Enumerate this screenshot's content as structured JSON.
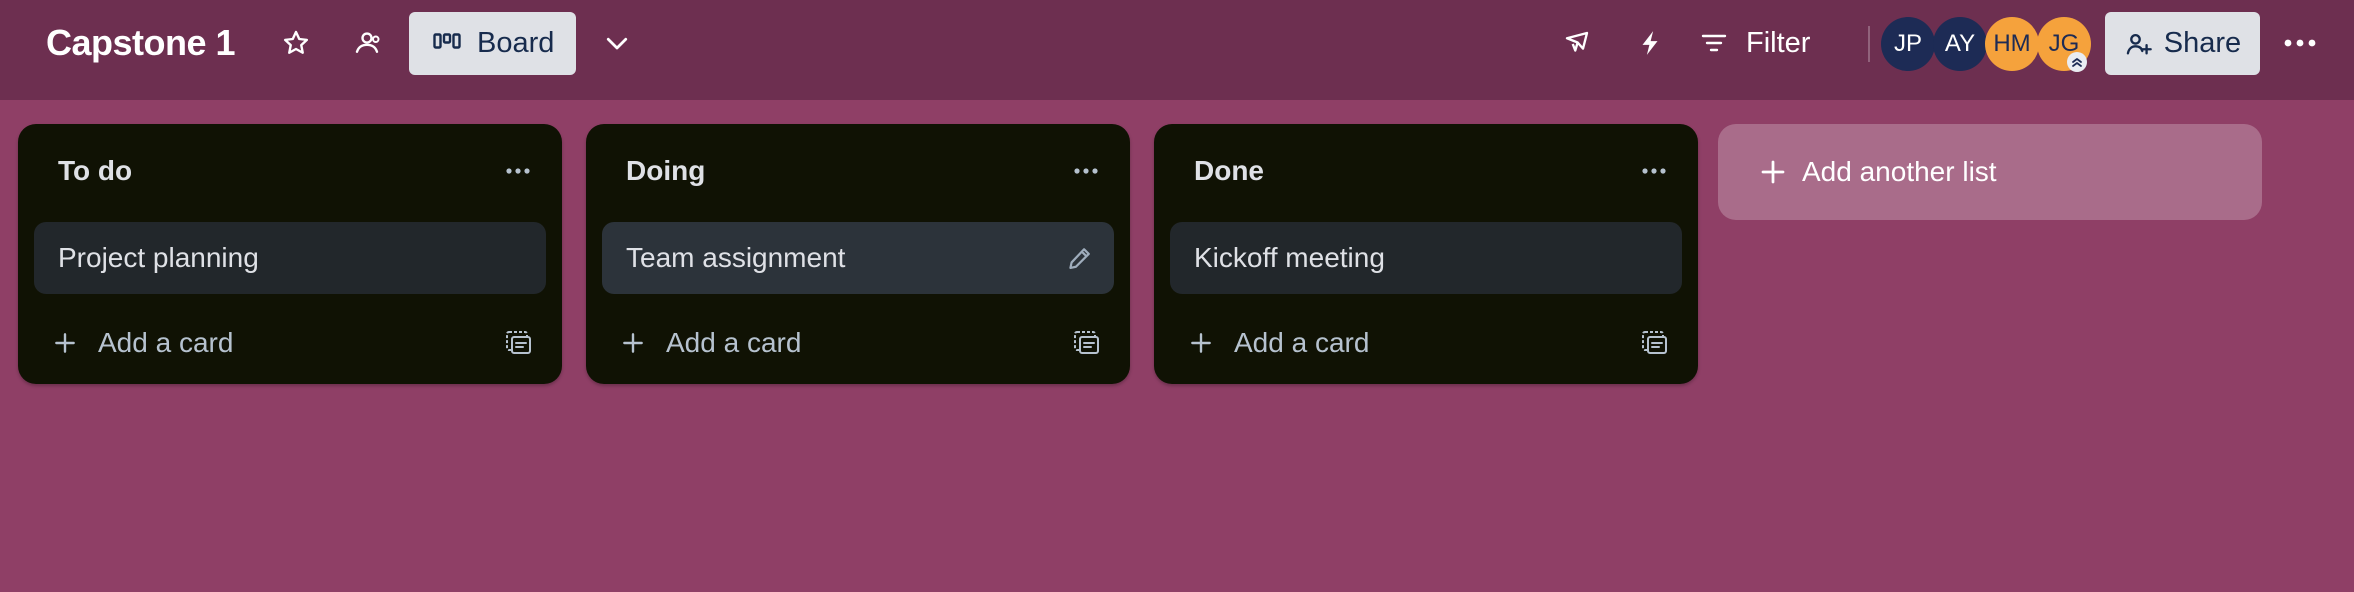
{
  "board": {
    "title": "Capstone 1",
    "view_label": "Board",
    "filter_label": "Filter",
    "share_label": "Share",
    "icons": {
      "star": "star-icon",
      "visibility": "workspace-visible-icon",
      "view": "board-view-icon",
      "view_switch": "chevron-down-icon",
      "power_ups": "rocket-icon",
      "automation": "lightning-icon",
      "filter": "filter-icon",
      "share": "add-person-icon",
      "menu": "more-horizontal-icon"
    },
    "colors": {
      "background": "#8f3f66",
      "header": "#6d2f50",
      "list": "#101204",
      "card": "#22272b"
    }
  },
  "members": [
    {
      "initials": "JP",
      "color": "#1d2b55"
    },
    {
      "initials": "AY",
      "color": "#1d2b55"
    },
    {
      "initials": "HM",
      "color": "#f5a23c"
    },
    {
      "initials": "JG",
      "color": "#f5a23c",
      "admin": true
    }
  ],
  "lists": [
    {
      "title": "To do",
      "cards": [
        {
          "title": "Project planning"
        }
      ],
      "add_card_label": "Add a card"
    },
    {
      "title": "Doing",
      "cards": [
        {
          "title": "Team assignment",
          "hovered": true
        }
      ],
      "add_card_label": "Add a card"
    },
    {
      "title": "Done",
      "cards": [
        {
          "title": "Kickoff meeting"
        }
      ],
      "add_card_label": "Add a card"
    }
  ],
  "add_list_label": "Add another list"
}
